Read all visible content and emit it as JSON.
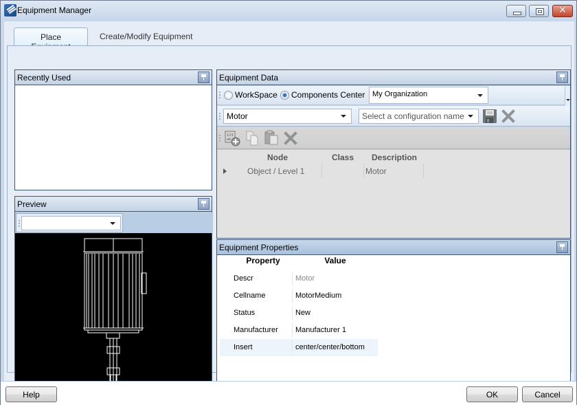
{
  "window": {
    "title": "Equipment Manager",
    "controls": {
      "minimize": "minimize",
      "maximize": "maximize",
      "close": "✕"
    }
  },
  "tabs": [
    {
      "label": "Place Equipment",
      "active": true
    },
    {
      "label": "Create/Modify Equipment",
      "active": false
    }
  ],
  "recently_used": {
    "title": "Recently Used",
    "items": []
  },
  "preview": {
    "title": "Preview",
    "view_select": {
      "value": ""
    }
  },
  "equipment_data": {
    "title": "Equipment Data",
    "source": {
      "options": [
        {
          "label": "WorkSpace",
          "checked": false
        },
        {
          "label": "Components Center",
          "checked": true
        }
      ],
      "organization": "My Organization"
    },
    "type_select": {
      "value": "Motor"
    },
    "configuration_select": {
      "placeholder": "Select a configuration name"
    },
    "grid": {
      "columns": [
        "Node",
        "Class",
        "Description"
      ],
      "rows": [
        {
          "node": "Object / Level 1",
          "class": "",
          "description": "Motor"
        }
      ]
    }
  },
  "equipment_properties": {
    "title": "Equipment Properties",
    "columns": [
      "Property",
      "Value"
    ],
    "rows": [
      {
        "property": "Descr",
        "value": "Motor"
      },
      {
        "property": "Cellname",
        "value": "MotorMedium"
      },
      {
        "property": "Status",
        "value": "New"
      },
      {
        "property": "Manufacturer",
        "value": "Manufacturer 1"
      },
      {
        "property": "Insert",
        "value": "center/center/bottom"
      }
    ]
  },
  "footer": {
    "help": "Help",
    "ok": "OK",
    "cancel": "Cancel"
  },
  "colors": {
    "accent": "#3e5673",
    "panel_header": "#c3d3e6",
    "preview_bg": "#000000",
    "close_button": "#c2432c"
  }
}
